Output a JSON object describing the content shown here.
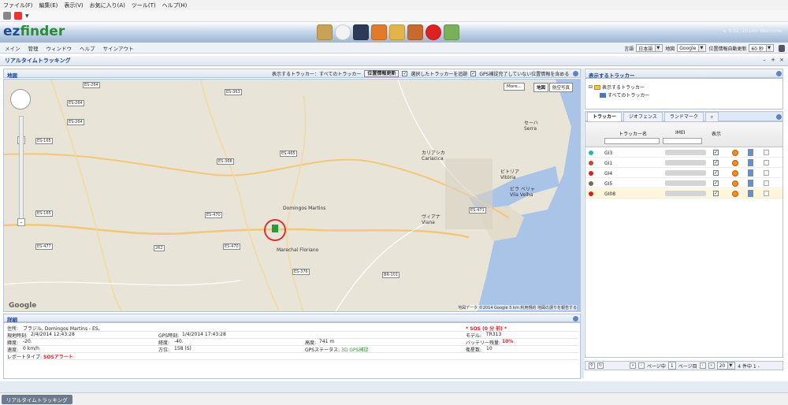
{
  "menu": [
    "ファイル(F)",
    "編集(E)",
    "表示(V)",
    "お気に入り(A)",
    "ツール(T)",
    "ヘルプ(H)"
  ],
  "logo": {
    "part1": "ez",
    "part2": "finder"
  },
  "welcome": "v. 5.02, 2014m Welcome",
  "nav": [
    "メイン",
    "管理",
    "ウィンドウ",
    "ヘルプ",
    "サインアウト"
  ],
  "settings": {
    "lang_label": "言語",
    "lang_value": "日本語",
    "map_label": "地図",
    "map_value": "Google",
    "refresh_label": "位置情報自動更新",
    "refresh_value": "60 秒"
  },
  "panel_title": "リアルタイムトラッキング",
  "map_panel": {
    "title": "地図",
    "show_label": "表示するトラッカー：すべてのトラッカー",
    "update_btn": "位置情報更新",
    "opt1": "選択したトラッカーを追跡",
    "opt2": "GPS補捉完了していない位置情報を含める",
    "more": "More...",
    "type_map": "地図",
    "type_sat": "航空写真",
    "footer": "地図データ ©2014 Google  5 km  利用規約  地図の誤りを報告する",
    "google": "Google",
    "cities": {
      "cariacica": "カリアシカ",
      "cariacica_en": "Cariacica",
      "vitoria": "ビトリア",
      "vitoria_en": "Vitória",
      "vilavelha": "ビラ ベリャ",
      "vilavelha_en": "Vila Velha",
      "viana": "ヴィアナ",
      "viana_en": "Viana",
      "domingos": "Domingos Martins",
      "marechal": "Marechal Floriano",
      "serra": "セーハ",
      "serra_en": "Serra"
    },
    "roads": [
      "ES-264",
      "ES-363",
      "ES-264",
      "ES-165",
      "ES-264",
      "ES-368",
      "ES-465",
      "ES-470",
      "ES-165",
      "ES-477",
      "ES-470",
      "ES-376",
      "BR-101",
      "ES-471",
      "262"
    ]
  },
  "detail": {
    "title": "詳細",
    "address_label": "住所:",
    "address_value": "ブラジル, Domingos Martins - ES,",
    "sos": "* SOS (0 分 前) *",
    "local_time_label": "現地時刻:",
    "local_time_value": "2/4/2014 12:43:28",
    "gps_time_label": "GPS時刻:",
    "gps_time_value": "1/4/2014 17:43:28",
    "model_label": "モデル:",
    "model_value": "TR313",
    "lat_label": "緯度:",
    "lat_value": "-20.",
    "lon_label": "経度:",
    "lon_value": "-40.",
    "alt_label": "高度:",
    "alt_value": "741 m",
    "battery_label": "バッテリー残量:",
    "battery_value": "10%",
    "speed_label": "速度:",
    "speed_value": "0 km/h",
    "dir_label": "方位:",
    "dir_value": "158 (S)",
    "gps_status_label": "GPSステータス:",
    "gps_status_value": "3D GPS補捉",
    "sat_label": "衛星数:",
    "sat_value": "10",
    "report_label": "レポートタイプ:",
    "report_value": "SOSアラート"
  },
  "right_panel": {
    "title": "表示するトラッカー",
    "tree_root": "表示するトラッカー",
    "tree_child": "すべてのトラッカー",
    "tabs": [
      "トラッカー",
      "ジオフェンス",
      "ランドマーク"
    ],
    "col_name": "トラッカー名",
    "col_imei": "IMEI",
    "col_show": "表示",
    "rows": [
      {
        "name": "GI3",
        "color": "#2bb5b0"
      },
      {
        "name": "GI1",
        "color": "#c24a3c"
      },
      {
        "name": "GI4",
        "color": "#d22222"
      },
      {
        "name": "GI5",
        "color": "#7d6a50"
      },
      {
        "name": "GI08",
        "color": "#d22222"
      }
    ],
    "pager": {
      "page_prefix": "ページ中",
      "page_value": "1",
      "page_suffix": "ページ目",
      "per_page": "20",
      "summary": "4 件中 1 -"
    }
  },
  "taskbar": "リアルタイムトラッキング"
}
